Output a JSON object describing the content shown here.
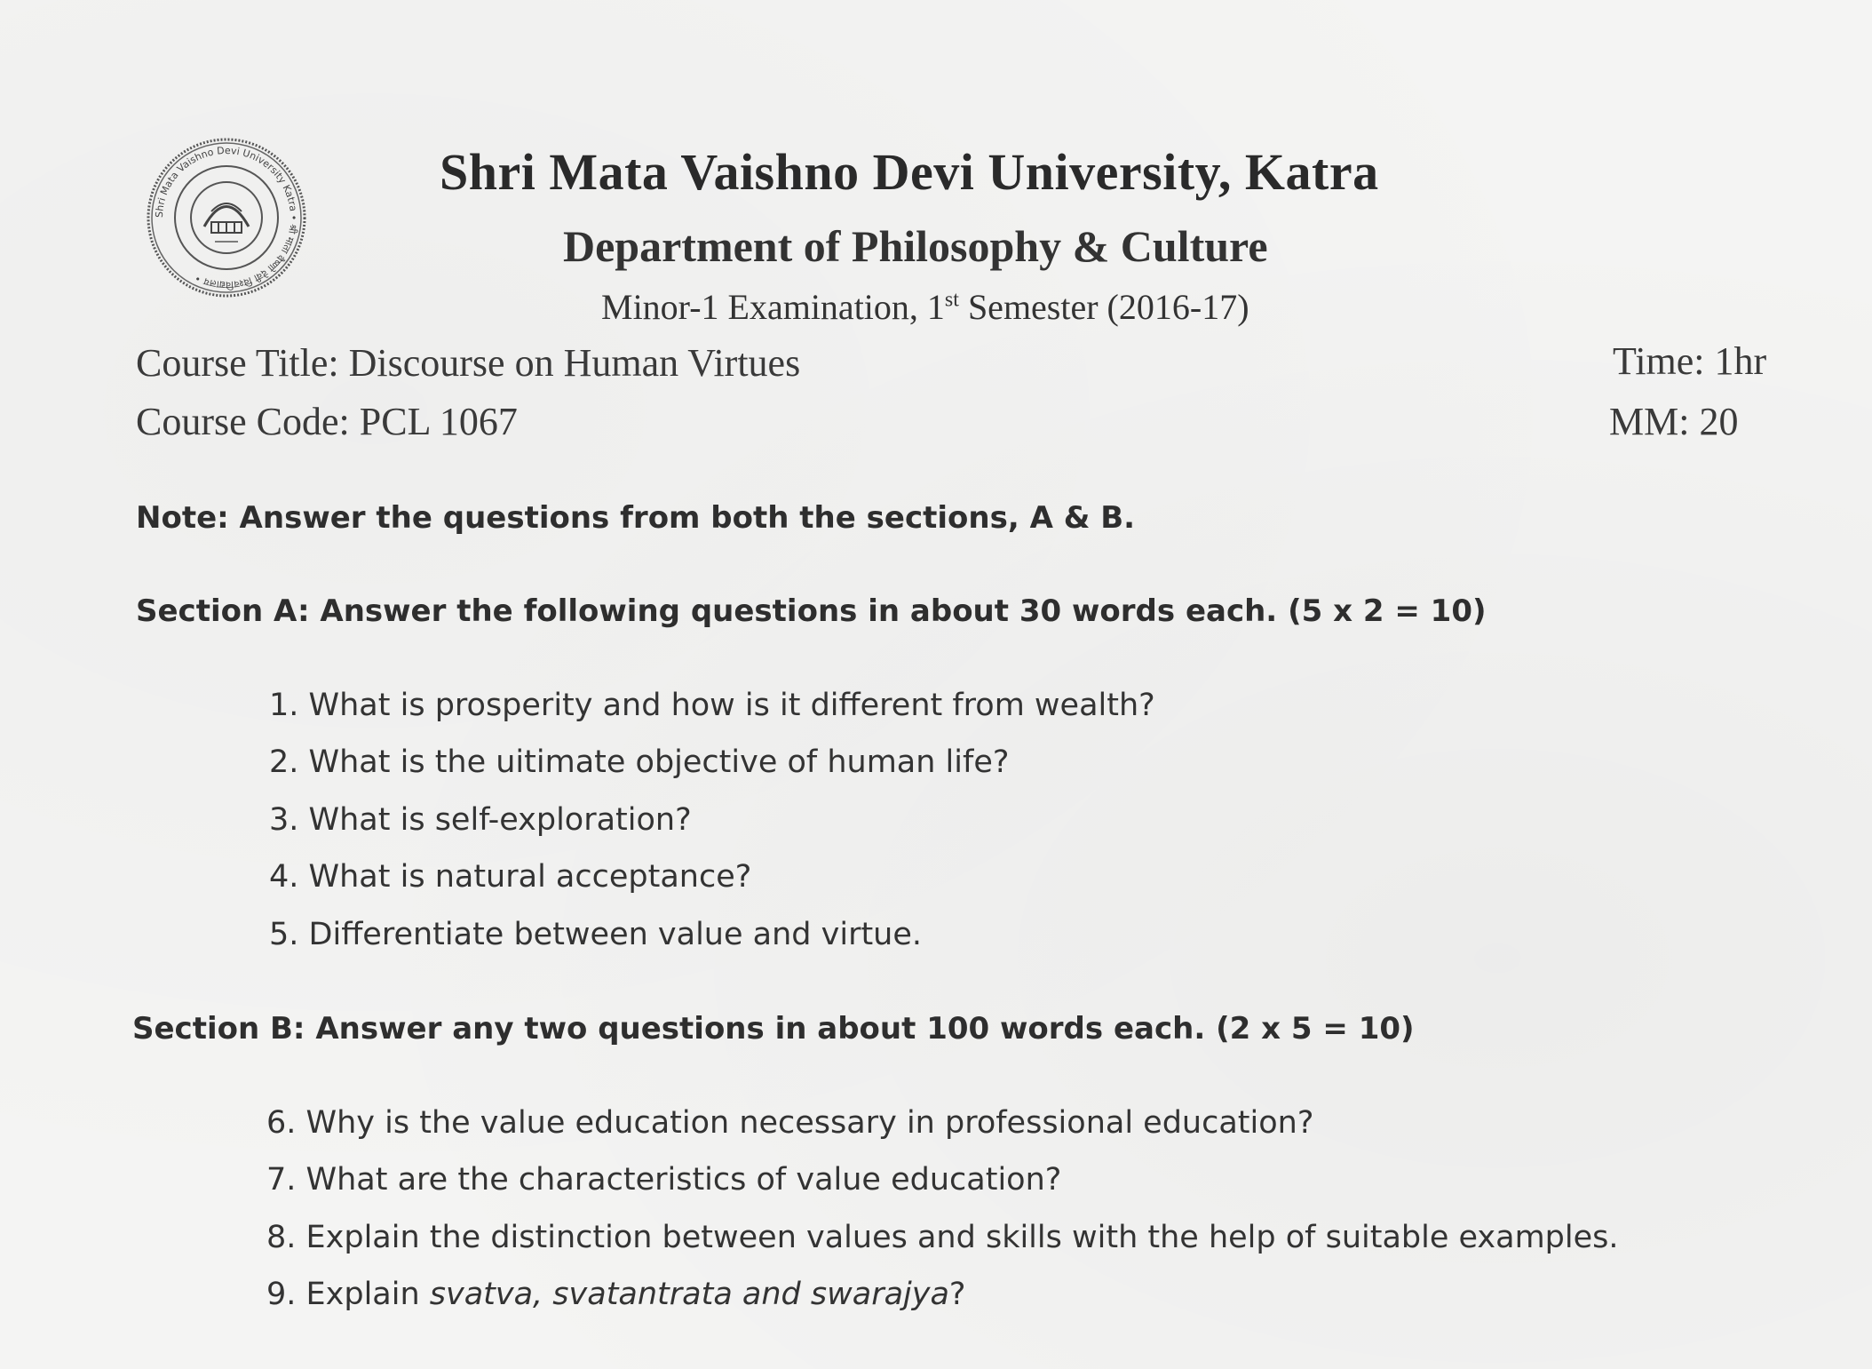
{
  "header": {
    "logo_name": "university-seal",
    "seal_text": "Shri Mata Vaishno Devi University Katra",
    "university": "Shri Mata Vaishno Devi University, Katra",
    "department": "Department of Philosophy & Culture",
    "exam_prefix": "Minor-1 Examination, 1",
    "exam_sup": "st",
    "exam_suffix": " Semester (2016-17)"
  },
  "course": {
    "title": "Course Title: Discourse on Human Virtues",
    "code": "Course Code: PCL 1067",
    "time": "Time: 1hr",
    "max_marks": "MM: 20"
  },
  "note": "Note: Answer the questions from both the sections, A & B.",
  "section_a": {
    "heading": "Section A: Answer the following questions in about 30 words each. (5 x 2 = 10)",
    "questions": [
      "1. What is prosperity and how is it different from wealth?",
      "2. What is the uitimate objective of human life?",
      "3. What is self-exploration?",
      "4. What is natural acceptance?",
      "5. Differentiate between value and virtue."
    ]
  },
  "section_b": {
    "heading": "Section B: Answer any two questions in about 100 words each. (2 x 5 = 10)",
    "questions": [
      "6. Why is the value education necessary in professional education?",
      "7. What are the characteristics of value education?",
      "8. Explain the distinction between values and skills with the help of suitable examples."
    ],
    "q9_prefix": "9. Explain ",
    "q9_italic": "svatva, svatantrata and swarajya",
    "q9_suffix": "?"
  }
}
